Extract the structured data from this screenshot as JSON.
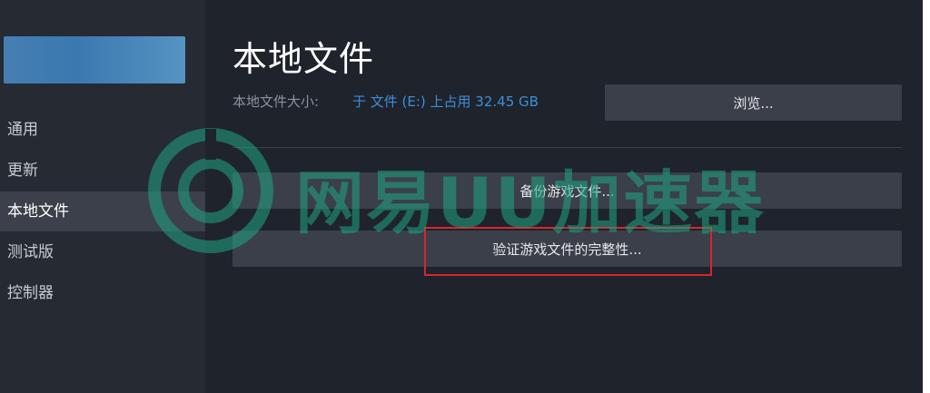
{
  "sidebar": {
    "items": [
      {
        "label": "通用"
      },
      {
        "label": "更新"
      },
      {
        "label": "本地文件",
        "active": true
      },
      {
        "label": "测试版"
      },
      {
        "label": "控制器"
      }
    ]
  },
  "main": {
    "title": "本地文件",
    "size_label": "本地文件大小:",
    "size_value": "于 文件 (E:) 上占用 32.45 GB",
    "browse_label": "浏览...",
    "backup_label": "备份游戏文件...",
    "verify_label": "验证游戏文件的完整性..."
  },
  "watermark": {
    "text": "网易UU加速器",
    "icon": "uu-logo-icon",
    "color": "#1fa583"
  },
  "colors": {
    "accent": "#3d8fd9",
    "highlight": "#d8252e"
  }
}
